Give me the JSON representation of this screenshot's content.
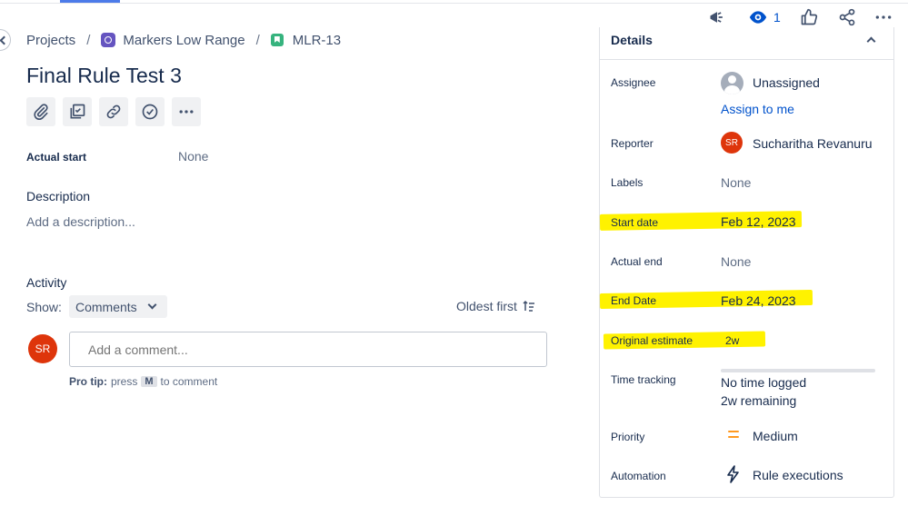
{
  "breadcrumb": {
    "projects": "Projects",
    "project": "Markers Low Range",
    "issue_key": "MLR-13"
  },
  "issue": {
    "title": "Final Rule Test 3"
  },
  "fields": {
    "actual_start_label": "Actual start",
    "actual_start_value": "None"
  },
  "description": {
    "heading": "Description",
    "placeholder": "Add a description..."
  },
  "activity": {
    "heading": "Activity",
    "show_label": "Show:",
    "show_value": "Comments",
    "sort_label": "Oldest first",
    "comment_placeholder": "Add a comment...",
    "protip_bold": "Pro tip:",
    "protip_press": "press",
    "protip_key": "M",
    "protip_rest": "to comment"
  },
  "user": {
    "initials": "SR"
  },
  "header_actions": {
    "watch_count": "1"
  },
  "details": {
    "title": "Details",
    "assignee": {
      "label": "Assignee",
      "value": "Unassigned",
      "link": "Assign to me"
    },
    "reporter": {
      "label": "Reporter",
      "value": "Sucharitha Revanuru",
      "initials": "SR"
    },
    "labels": {
      "label": "Labels",
      "value": "None"
    },
    "start_date": {
      "label": "Start date",
      "value": "Feb 12, 2023"
    },
    "actual_end": {
      "label": "Actual end",
      "value": "None"
    },
    "end_date": {
      "label": "End Date",
      "value": "Feb 24, 2023"
    },
    "original_estimate": {
      "label": "Original estimate",
      "value": "2w"
    },
    "time_tracking": {
      "label": "Time tracking",
      "logged": "No time logged",
      "remaining": "2w remaining",
      "progress": 0
    },
    "priority": {
      "label": "Priority",
      "value": "Medium"
    },
    "automation": {
      "label": "Automation",
      "value": "Rule executions"
    }
  },
  "colors": {
    "highlight": "#fff200",
    "link": "#0052cc",
    "avatar": "#de350b",
    "priority_medium": "#ff991f",
    "project_icon": "#6554c0",
    "story_icon": "#36b37e"
  }
}
